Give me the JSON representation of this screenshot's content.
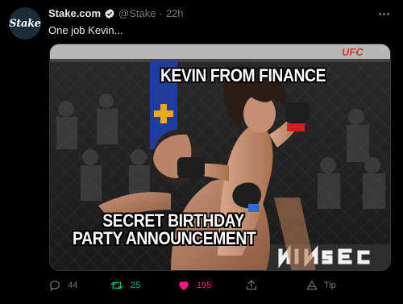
{
  "author": {
    "avatar_text": "Stake",
    "name": "Stake.com",
    "handle": "@Stake",
    "separator": "·",
    "time": "22h"
  },
  "tweet_text": "One job Kevin...",
  "media": {
    "caption_top": "KEVIN FROM FINANCE",
    "caption_bottom_line1": "SECRET BIRTHDAY",
    "caption_bottom_line2": "PARTY ANNOUNCEMENT",
    "banner_text": "UFC"
  },
  "actions": {
    "replies": "44",
    "retweets": "25",
    "likes": "195",
    "tip_label": "Tip"
  },
  "colors": {
    "background": "#000000",
    "retweet_green": "#00ba7c",
    "like_pink": "#f91880",
    "muted": "#71767b"
  }
}
